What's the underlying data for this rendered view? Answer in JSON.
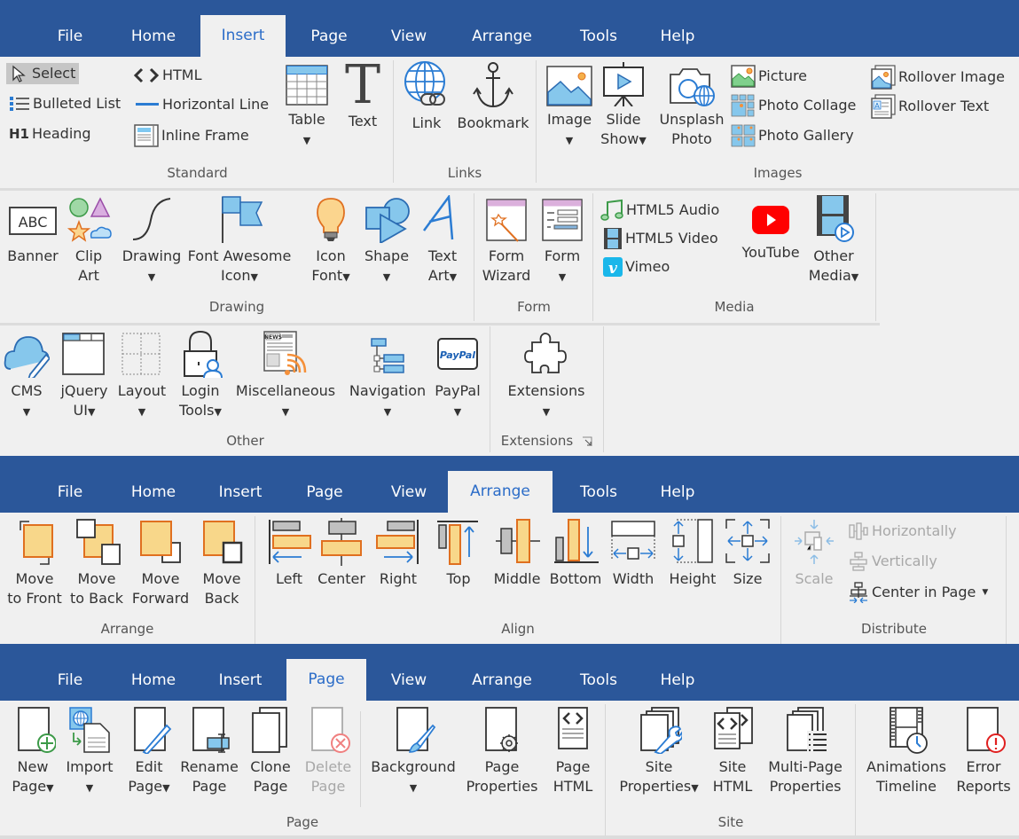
{
  "colors": {
    "accent": "#2b579a",
    "active_tab_text": "#2b6cc8",
    "panel_bg": "#f0f0f0"
  },
  "ribbon1": {
    "tabs": [
      {
        "label": "File"
      },
      {
        "label": "Home"
      },
      {
        "label": "Insert",
        "active": true
      },
      {
        "label": "Page"
      },
      {
        "label": "View"
      },
      {
        "label": "Arrange"
      },
      {
        "label": "Tools"
      },
      {
        "label": "Help"
      }
    ],
    "groups": {
      "standard": "Standard",
      "links": "Links",
      "images": "Images",
      "drawing": "Drawing",
      "form": "Form",
      "media": "Media",
      "other": "Other",
      "extensions": "Extensions"
    },
    "standard": {
      "select": "Select",
      "bulleted_list": "Bulleted List",
      "heading": "Heading",
      "heading_icon": "H1",
      "html": "HTML",
      "horizontal_line": "Horizontal Line",
      "inline_frame": "Inline Frame",
      "table": "Table",
      "text": "Text"
    },
    "links": {
      "link": "Link",
      "bookmark": "Bookmark"
    },
    "images": {
      "image": "Image",
      "slide": "Slide",
      "show": "Show",
      "unsplash": "Unsplash",
      "photo": "Photo",
      "picture": "Picture",
      "photo_collage": "Photo Collage",
      "photo_gallery": "Photo Gallery",
      "rollover_image": "Rollover Image",
      "rollover_text": "Rollover Text"
    },
    "drawing": {
      "banner": "Banner",
      "banner_icon": "ABC",
      "clip": "Clip",
      "art": "Art",
      "drawing": "Drawing",
      "font_awesome": "Font Awesome",
      "icon": "Icon",
      "icon2": "Icon",
      "font": "Font",
      "shape": "Shape",
      "text": "Text",
      "art2": "Art"
    },
    "form": {
      "form": "Form",
      "wizard": "Wizard",
      "form2": "Form"
    },
    "media": {
      "audio": "HTML5 Audio",
      "video": "HTML5 Video",
      "vimeo": "Vimeo",
      "youtube": "YouTube",
      "other": "Other",
      "media": "Media"
    },
    "other": {
      "cms": "CMS",
      "jquery": "jQuery",
      "ui": "UI",
      "layout": "Layout",
      "login": "Login",
      "tools": "Tools",
      "misc": "Miscellaneous",
      "navigation": "Navigation",
      "paypal": "PayPal",
      "paypal_icon": "PayPal",
      "news_icon": "NEWS"
    },
    "extensions": {
      "extensions": "Extensions"
    }
  },
  "ribbon2": {
    "tabs": [
      {
        "label": "File"
      },
      {
        "label": "Home"
      },
      {
        "label": "Insert"
      },
      {
        "label": "Page"
      },
      {
        "label": "View"
      },
      {
        "label": "Arrange",
        "active": true
      },
      {
        "label": "Tools"
      },
      {
        "label": "Help"
      }
    ],
    "groups": {
      "arrange": "Arrange",
      "align": "Align",
      "distribute": "Distribute"
    },
    "arrange": [
      {
        "l1": "Move",
        "l2": "to Front"
      },
      {
        "l1": "Move",
        "l2": "to Back"
      },
      {
        "l1": "Move",
        "l2": "Forward"
      },
      {
        "l1": "Move",
        "l2": "Back"
      }
    ],
    "align": [
      "Left",
      "Center",
      "Right",
      "Top",
      "Middle",
      "Bottom",
      "Width",
      "Height",
      "Size"
    ],
    "distribute": {
      "scale": "Scale",
      "horizontally": "Horizontally",
      "vertically": "Vertically",
      "center_in_page": "Center in Page"
    }
  },
  "ribbon3": {
    "tabs": [
      {
        "label": "File"
      },
      {
        "label": "Home"
      },
      {
        "label": "Insert"
      },
      {
        "label": "Page",
        "active": true
      },
      {
        "label": "View"
      },
      {
        "label": "Arrange"
      },
      {
        "label": "Tools"
      },
      {
        "label": "Help"
      }
    ],
    "groups": {
      "page": "Page",
      "site": "Site"
    },
    "page": [
      {
        "l1": "New",
        "l2": "Page"
      },
      {
        "l1": "Import",
        "l2": ""
      },
      {
        "l1": "Edit",
        "l2": "Page"
      },
      {
        "l1": "Rename",
        "l2": "Page"
      },
      {
        "l1": "Clone",
        "l2": "Page"
      },
      {
        "l1": "Delete",
        "l2": "Page"
      },
      {
        "l1": "Background",
        "l2": ""
      },
      {
        "l1": "Page",
        "l2": "Properties"
      },
      {
        "l1": "Page",
        "l2": "HTML"
      }
    ],
    "site": [
      {
        "l1": "Site",
        "l2": "Properties"
      },
      {
        "l1": "Site",
        "l2": "HTML"
      },
      {
        "l1": "Multi-Page",
        "l2": "Properties"
      },
      {
        "l1": "Animations",
        "l2": "Timeline"
      },
      {
        "l1": "Error",
        "l2": "Reports"
      }
    ]
  }
}
